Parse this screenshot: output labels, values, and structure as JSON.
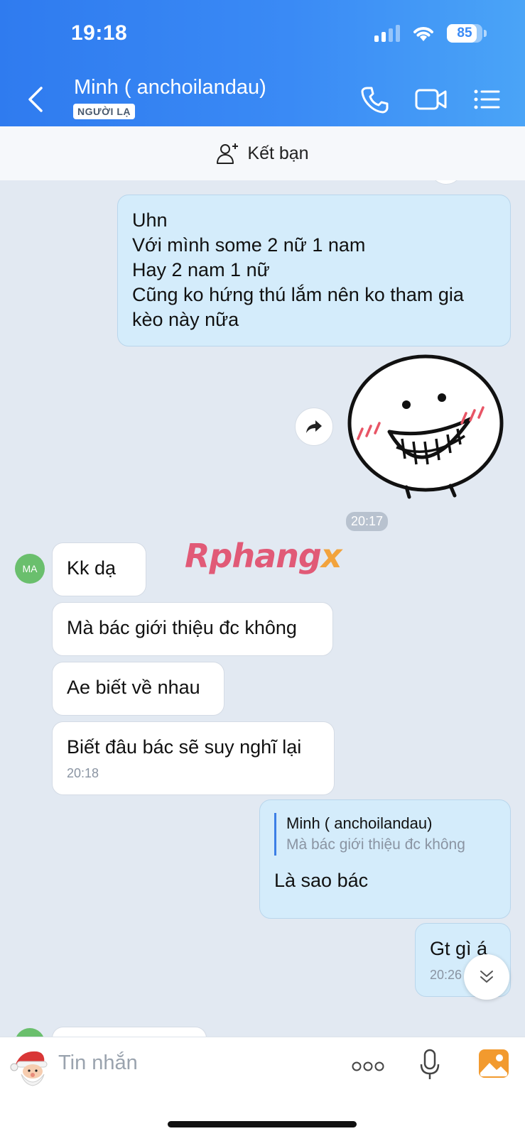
{
  "status_bar": {
    "time": "19:18",
    "battery": "85"
  },
  "header": {
    "contact_name": "Minh ( anchoilandau)",
    "badge": "NGƯỜI LẠ"
  },
  "friend_bar": {
    "label": "Kết bạn"
  },
  "messages": {
    "m1": {
      "lines": [
        "Uhn",
        "Với mình some 2 nữ 1 nam",
        "Hay 2 nam 1 nữ",
        "Cũng ko hứng thú lắm nên ko tham gia",
        "kèo này nữa"
      ]
    },
    "time_chip": "20:17",
    "avatar": "MA",
    "r1": "Kk dạ",
    "r2": "Mà bác giới thiệu đc không",
    "r3": "Ae biết về nhau",
    "r4": {
      "text": "Biết đâu bác sẽ suy nghĩ lại",
      "time": "20:18"
    },
    "reply": {
      "quote_name": "Minh ( anchoilandau)",
      "quote_text": "Mà bác giới thiệu đc không",
      "text": "Là sao bác"
    },
    "m2": {
      "text": "Gt gì á",
      "time": "20:26"
    }
  },
  "watermark": {
    "a": "Rphang",
    "b": "x"
  },
  "input": {
    "placeholder": "Tin nhắn"
  },
  "colors": {
    "header_start": "#2f7bef",
    "header_end": "#4aa4f7",
    "my_bubble": "#d4ecfb",
    "chat_bg": "#e2e9f2"
  }
}
